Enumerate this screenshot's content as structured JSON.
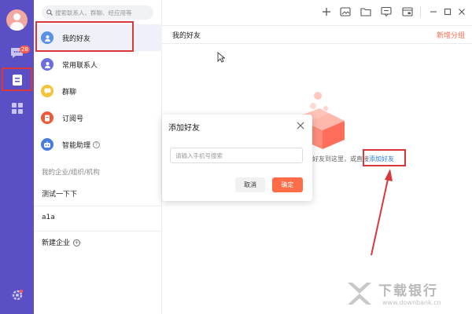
{
  "rail": {
    "chat_badge": "28",
    "accent": "#5a4fc4"
  },
  "search": {
    "placeholder": "搜索联系人、群聊、经应用等"
  },
  "nav": {
    "my_friends": "我的好友",
    "contacts": "常用联系人",
    "groups": "群聊",
    "subscriptions": "订阅号",
    "assistant": "智能助理"
  },
  "orgs": {
    "section_label": "我的企业/组织/机构",
    "items": [
      "测试一下下",
      "a1a"
    ],
    "new_label": "新建企业"
  },
  "main": {
    "title": "我的好友",
    "new_group": "新增分组",
    "empty_text": "好友到这里，或直接",
    "add_link": "添加好友"
  },
  "dialog": {
    "title": "添加好友",
    "input_placeholder": "请输入手机号搜索",
    "cancel": "取消",
    "confirm": "确定"
  },
  "watermark": {
    "title": "下载银行",
    "subtitle": "www.downbank.cn"
  },
  "colors": {
    "highlight": "#d9383a",
    "confirm": "#ff6d48",
    "link": "#2a7ae2"
  }
}
